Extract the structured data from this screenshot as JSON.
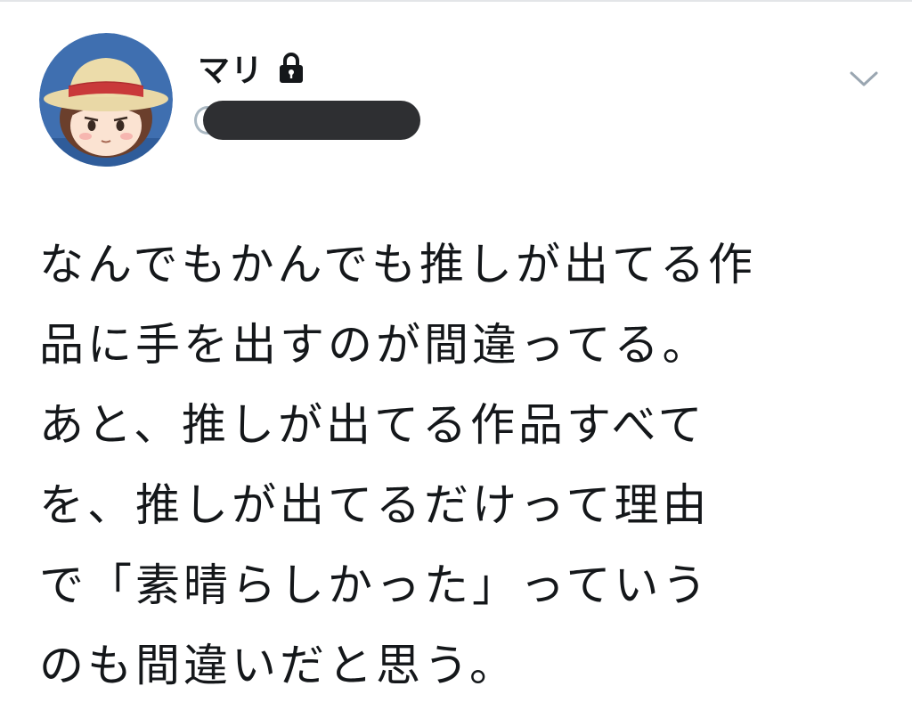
{
  "tweet": {
    "author": {
      "display_name": "マリ",
      "protected": true,
      "lock_icon": "lock-icon",
      "handle_redacted": true,
      "avatar": "avatar-straw-hat-character"
    },
    "menu_icon": "chevron-down-icon",
    "text_lines": [
      "なんでもかんでも推しが出てる作",
      "品に手を出すのが間違ってる。",
      "あと、推しが出てる作品すべて",
      "を、推しが出てるだけって理由",
      "で「素晴らしかった」っていう",
      "のも間違いだと思う。"
    ]
  }
}
